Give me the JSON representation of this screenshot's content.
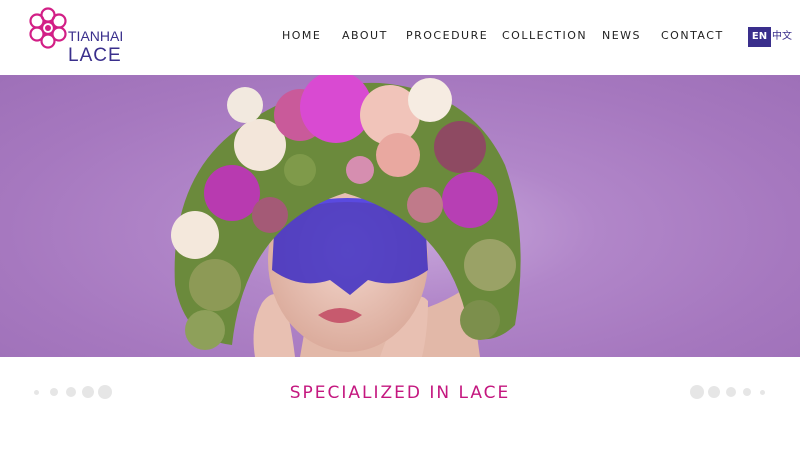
{
  "brand": {
    "name_line1": "TIANHAI",
    "name_line2": "LACE",
    "logo_color": "#d21f86",
    "text_color": "#3a2f8c"
  },
  "nav": {
    "items": [
      {
        "label": "HOME"
      },
      {
        "label": "ABOUT"
      },
      {
        "label": "PROCEDURE"
      },
      {
        "label": "COLLECTION"
      },
      {
        "label": "NEWS"
      },
      {
        "label": "CONTACT"
      }
    ]
  },
  "language": {
    "current": "EN",
    "alternate": "中文"
  },
  "hero": {
    "background_color": "#a678bf",
    "image_subject": "woman-wearing-flower-crown-and-blue-lace-mask"
  },
  "tagline": "SPECIALIZED IN LACE",
  "tagline_color": "#c4177f"
}
